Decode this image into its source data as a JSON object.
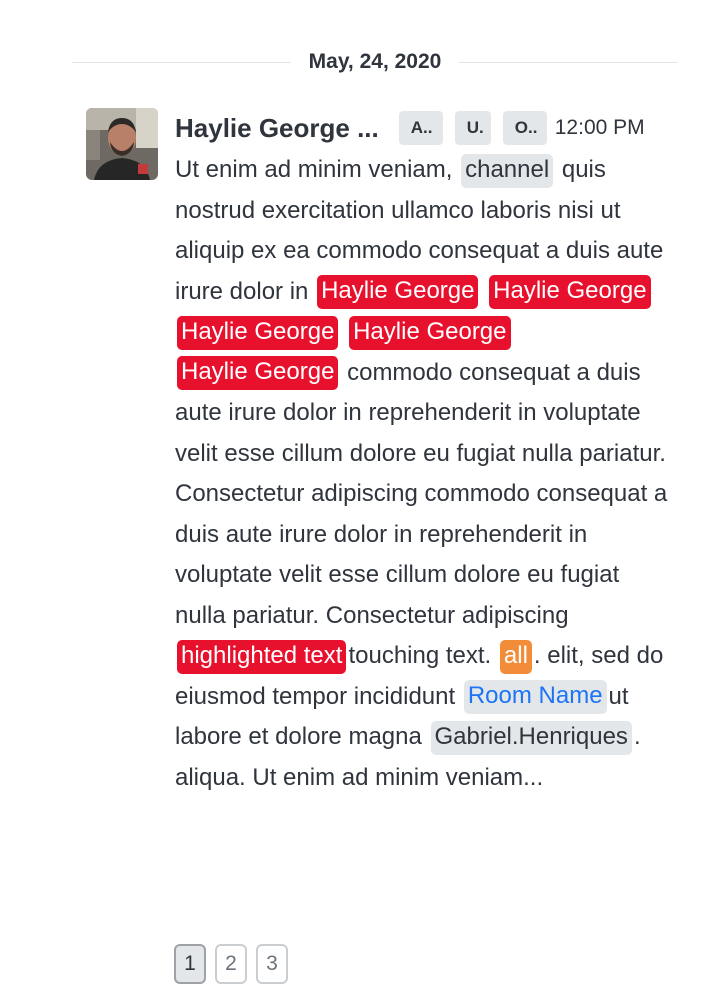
{
  "divider": {
    "date": "May, 24, 2020"
  },
  "message": {
    "author": "Haylie George ...",
    "roles": [
      "A..",
      "U.",
      "O.."
    ],
    "time": "12:00 PM",
    "segments": {
      "t1": "Ut enim ad minim veniam, ",
      "channel": "channel",
      "t2": " quis nostrud exercitation ullamco laboris nisi ut aliquip ex ea commodo consequat a duis aute irure dolor in ",
      "mention": "Haylie George",
      "t3": "commodo consequat a duis aute irure dolor in reprehenderit in voluptate velit esse cillum dolore eu fugiat nulla pariatur. Consectetur adipiscing commodo consequat a duis aute irure dolor in reprehenderit in voluptate velit esse cillum dolore eu fugiat nulla pariatur. Consectetur adipiscing ",
      "highlight": "highlighted text",
      "t4": "touching text. ",
      "all": "all",
      "t5": ". elit, sed do eiusmod tempor incididunt ",
      "room": "Room Name",
      "t6": "ut labore et dolore magna ",
      "user": "Gabriel.Henriques",
      "t7": ". aliqua. Ut enim ad minim veniam..."
    }
  },
  "pagination": {
    "pages": [
      "1",
      "2",
      "3"
    ],
    "active": "1"
  },
  "colors": {
    "mention": "#e8112d",
    "all": "#f38c39",
    "link": "#1d74f5",
    "chip_bg": "#e4e7ea",
    "text": "#2f343d"
  }
}
